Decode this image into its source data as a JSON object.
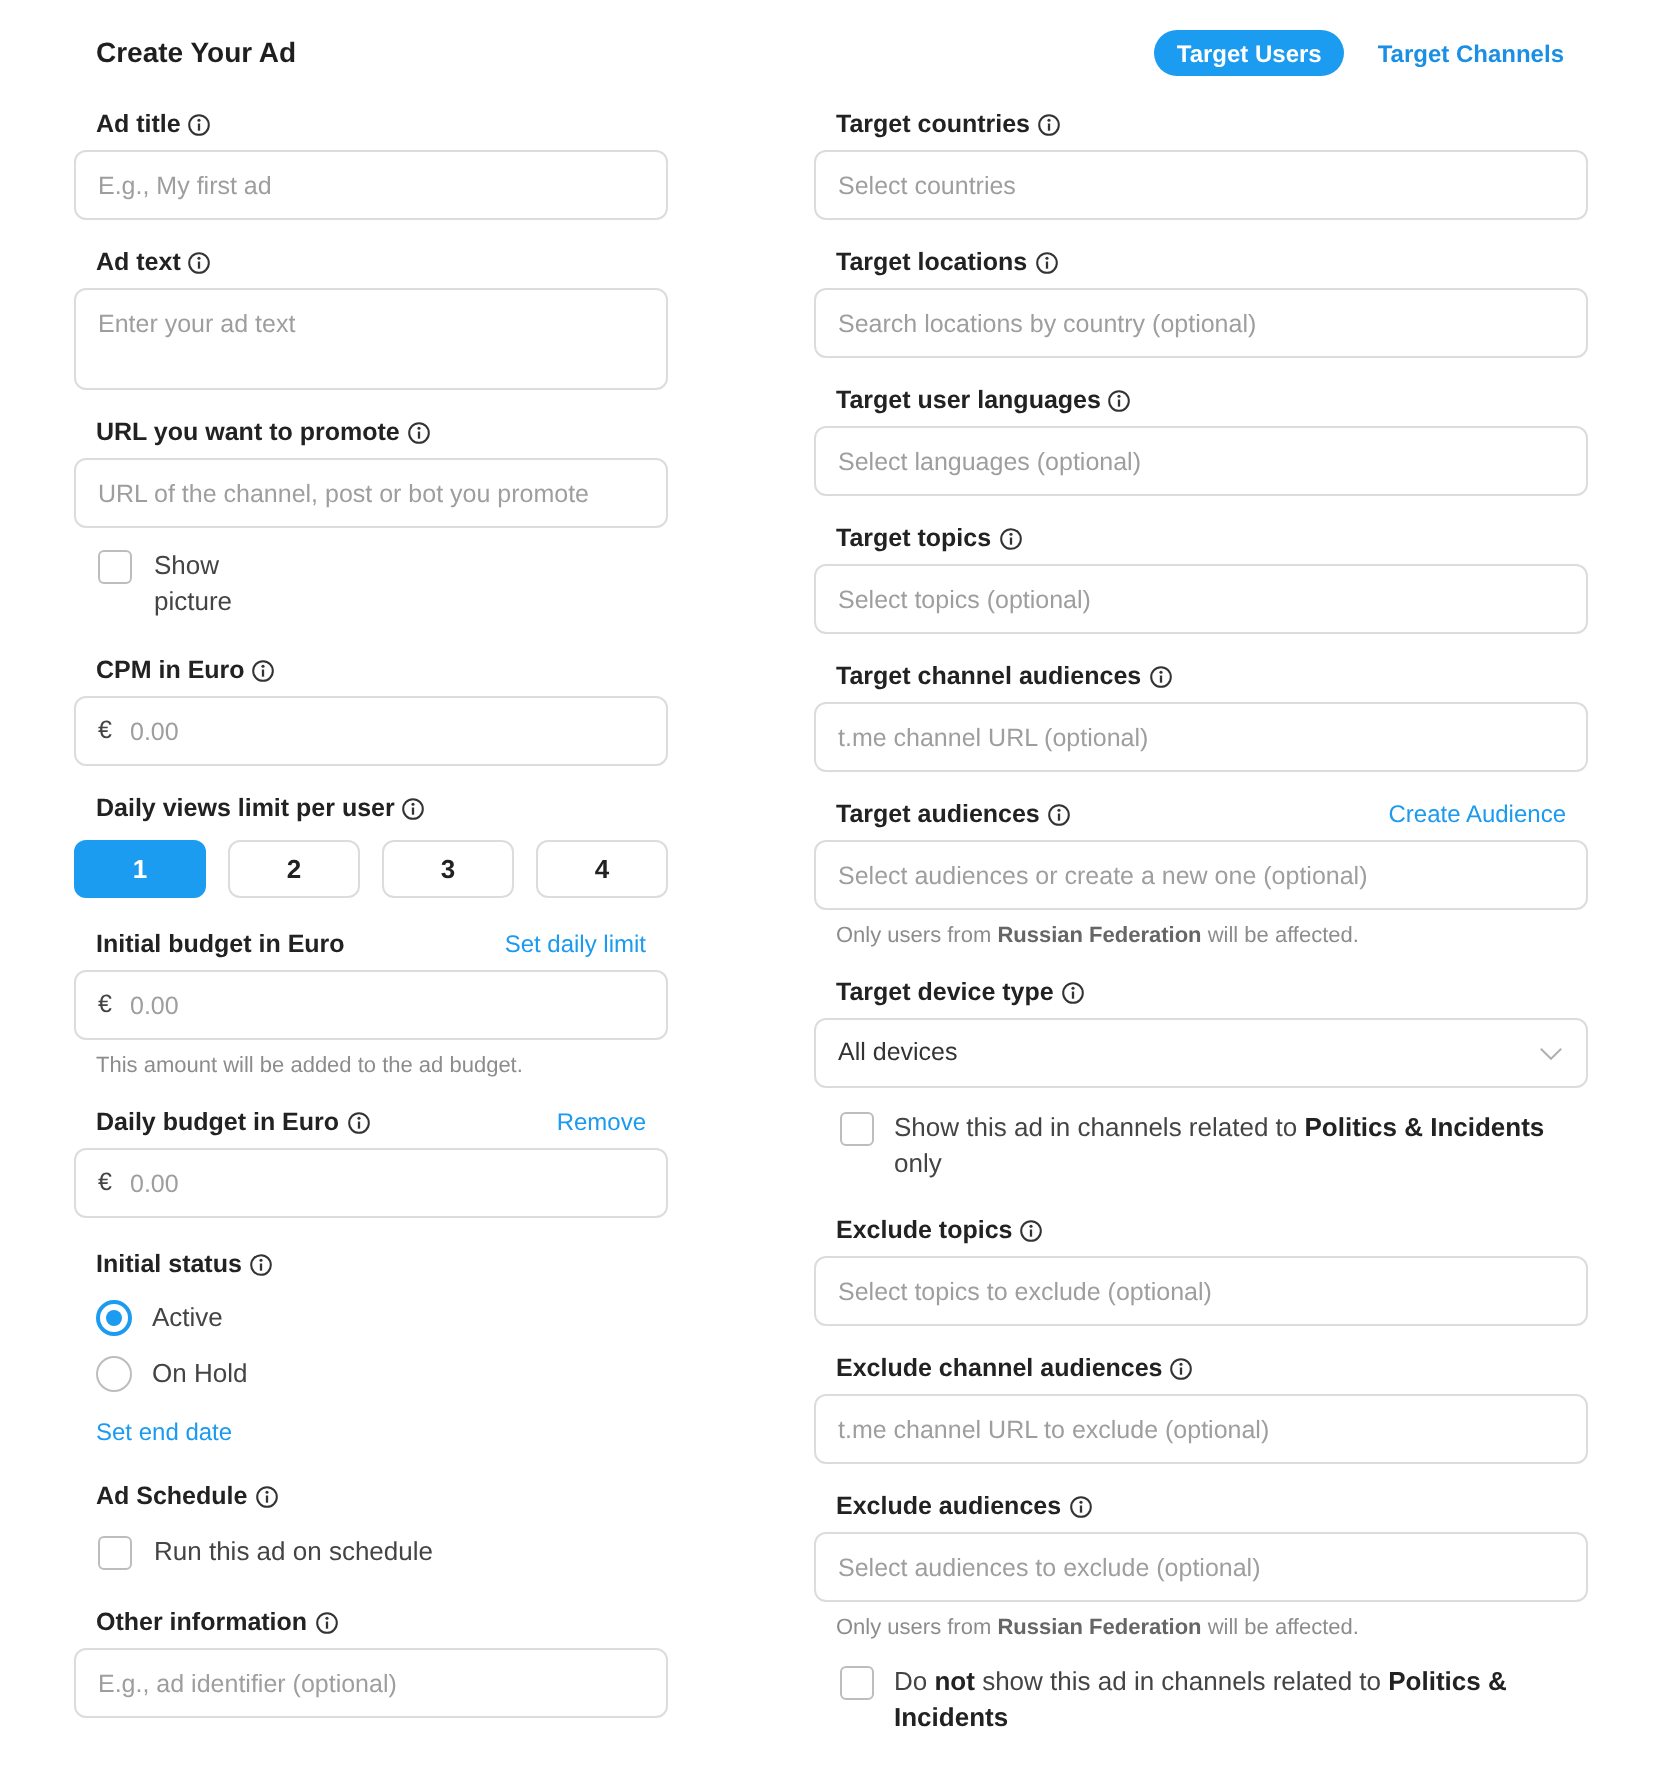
{
  "title": "Create Your Ad",
  "tabs": [
    {
      "label": "Target Users",
      "selected": true
    },
    {
      "label": "Target Channels",
      "selected": false
    }
  ],
  "left_form": [
    {
      "kind": "input",
      "label": "Ad title",
      "info": true,
      "placeholder": "E.g., My first ad"
    },
    {
      "kind": "textarea",
      "label": "Ad text",
      "info": true,
      "placeholder": "Enter your ad text"
    },
    {
      "kind": "input",
      "label": "URL you want to promote",
      "info": true,
      "placeholder": "URL of the channel, post or bot you promote"
    },
    {
      "kind": "checkbox",
      "text": "Show picture",
      "checked": false
    },
    {
      "kind": "amount",
      "label": "CPM in Euro",
      "info": true,
      "currency": "€",
      "placeholder": "0.00"
    },
    {
      "kind": "options",
      "label": "Daily views limit per user",
      "info": true,
      "options": [
        {
          "label": "1",
          "selected": true
        },
        {
          "label": "2",
          "selected": false
        },
        {
          "label": "3",
          "selected": false
        },
        {
          "label": "4",
          "selected": false
        }
      ]
    },
    {
      "kind": "amount",
      "label": "Initial budget in Euro",
      "info": false,
      "link": "Set daily limit",
      "currency": "€",
      "placeholder": "0.00",
      "note": "This amount will be added to the ad budget."
    },
    {
      "kind": "amount",
      "label": "Daily budget in Euro",
      "info": true,
      "link": "Remove",
      "currency": "€",
      "placeholder": "0.00"
    },
    {
      "kind": "radio",
      "label": "Initial status",
      "info": true,
      "options": [
        {
          "label": "Active",
          "selected": true
        },
        {
          "label": "On Hold",
          "selected": false
        }
      ]
    },
    {
      "kind": "link",
      "text": "Set end date"
    },
    {
      "kind": "checkbox",
      "label": "Ad Schedule",
      "info": true,
      "text": "Run this ad on schedule",
      "checked": false
    },
    {
      "kind": "input",
      "label": "Other information",
      "info": true,
      "placeholder": "E.g., ad identifier (optional)"
    }
  ],
  "right_form": [
    {
      "kind": "input",
      "label": "Target countries",
      "info": true,
      "placeholder": "Select countries"
    },
    {
      "kind": "input",
      "label": "Target locations",
      "info": true,
      "placeholder": "Search locations by country (optional)"
    },
    {
      "kind": "input",
      "label": "Target user languages",
      "info": true,
      "placeholder": "Select languages (optional)"
    },
    {
      "kind": "input",
      "label": "Target topics",
      "info": true,
      "placeholder": "Select topics (optional)"
    },
    {
      "kind": "input",
      "label": "Target channel audiences",
      "info": true,
      "placeholder": "t.me channel URL (optional)"
    },
    {
      "kind": "input",
      "label": "Target audiences",
      "info": true,
      "link": "Create Audience",
      "placeholder": "Select audiences or create a new one (optional)",
      "note": "Only users from **Russian Federation** will be affected."
    },
    {
      "kind": "select",
      "label": "Target device type",
      "info": true,
      "value": "All devices"
    },
    {
      "kind": "checkbox",
      "text": "Show this ad in channels related to **Politics & Incidents** only",
      "checked": false
    },
    {
      "kind": "input",
      "label": "Exclude topics",
      "info": true,
      "placeholder": "Select topics to exclude (optional)"
    },
    {
      "kind": "input",
      "label": "Exclude channel audiences",
      "info": true,
      "placeholder": "t.me channel URL to exclude (optional)"
    },
    {
      "kind": "input",
      "label": "Exclude audiences",
      "info": true,
      "placeholder": "Select audiences to exclude (optional)",
      "note": "Only users from **Russian Federation** will be affected."
    },
    {
      "kind": "checkbox",
      "text": "Do **not** show this ad in channels related to **Politics & Incidents**",
      "checked": false
    }
  ]
}
